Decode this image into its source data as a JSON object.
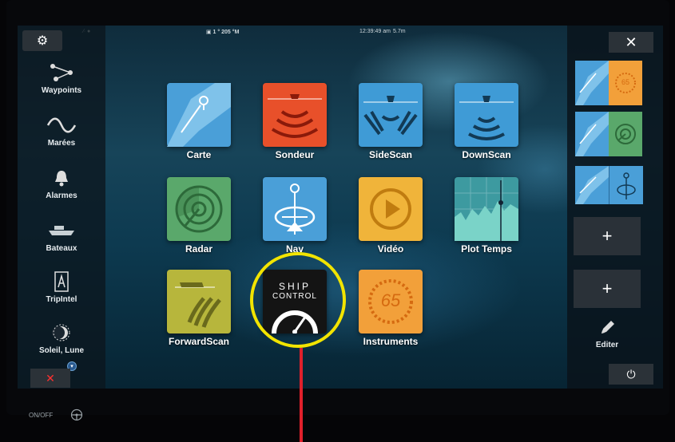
{
  "status": {
    "left": "∕∙ ●",
    "center": "▣ 1 ° 205 °M",
    "time": "12:39:49 am",
    "depth": "5.7m"
  },
  "left_sidebar": {
    "items": [
      {
        "label": "Waypoints",
        "icon": "waypoints-icon"
      },
      {
        "label": "Marées",
        "icon": "tide-wave-icon"
      },
      {
        "label": "Alarmes",
        "icon": "bell-icon"
      },
      {
        "label": "Bateaux",
        "icon": "ship-icon"
      },
      {
        "label": "TripIntel",
        "icon": "tripintel-icon"
      },
      {
        "label": "Soleil, Lune",
        "icon": "sun-moon-icon"
      }
    ]
  },
  "apps": [
    {
      "label": "Carte",
      "color": "#4a9fd8"
    },
    {
      "label": "Sondeur",
      "color": "#e8502a"
    },
    {
      "label": "SideScan",
      "color": "#3f9bd6"
    },
    {
      "label": "DownScan",
      "color": "#3f9bd6"
    },
    {
      "label": "Radar",
      "color": "#5aa86b"
    },
    {
      "label": "Nav",
      "color": "#4a9fd8"
    },
    {
      "label": "Vidéo",
      "color": "#f0b43a"
    },
    {
      "label": "Plot Temps",
      "color": "#3d9aa0"
    },
    {
      "label": "ForwardScan",
      "color": "#b7b63c"
    },
    {
      "label": "",
      "color": "#1a1a1a"
    },
    {
      "label": "Instruments",
      "color": "#f2a03a"
    }
  ],
  "ship_control": {
    "line1": "SHIP",
    "line2": "CONTROL"
  },
  "instrument_value": "65",
  "combo_value": "65",
  "right_sidebar": {
    "add_label": "+",
    "edit_label": "Editer"
  },
  "hardware": {
    "onoff": "ON/OFF"
  }
}
